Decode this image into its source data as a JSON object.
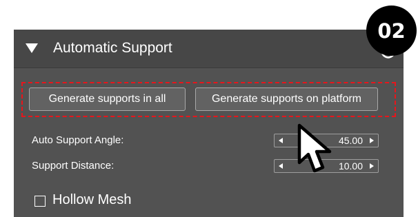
{
  "badge": {
    "text": "02"
  },
  "panel": {
    "title": "Automatic Support",
    "collapse_icon": "triangle-down-icon",
    "refresh_icon": "refresh-icon"
  },
  "buttons": {
    "generate_all": "Generate supports in all",
    "generate_platform": "Generate supports on platform"
  },
  "fields": {
    "auto_support_angle": {
      "label": "Auto Support Angle:",
      "value": "45.00"
    },
    "support_distance": {
      "label": "Support Distance:",
      "value": "10.00"
    }
  },
  "hollow_mesh": {
    "label": "Hollow Mesh",
    "checked": false
  },
  "colors": {
    "panel_bg": "#525252",
    "header_bg": "#474747",
    "highlight": "#e8151b",
    "badge_bg": "#000000"
  }
}
